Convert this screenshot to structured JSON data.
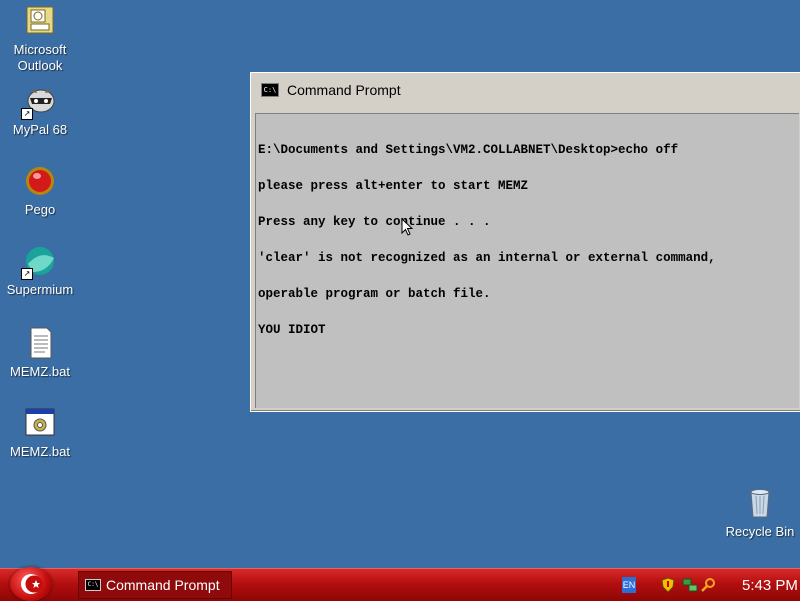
{
  "desktop": {
    "icons": [
      {
        "label_line1": "Microsoft",
        "label_line2": "Outlook",
        "icon": "outlook-icon"
      },
      {
        "label": "MyPal 68",
        "icon": "mypal-icon"
      },
      {
        "label": "Pego",
        "icon": "pego-icon"
      },
      {
        "label": "Supermium",
        "icon": "supermium-icon"
      },
      {
        "label": "MEMZ.bat",
        "icon": "text-file-icon"
      },
      {
        "label": "MEMZ.bat",
        "icon": "batch-file-icon"
      }
    ],
    "recycle_bin": {
      "label": "Recycle Bin",
      "icon": "recycle-bin-icon"
    }
  },
  "cmd_window": {
    "title": "Command Prompt",
    "icon_text": "C:\\",
    "lines": [
      "E:\\Documents and Settings\\VM2.COLLABNET\\Desktop>echo off",
      "please press alt+enter to start MEMZ",
      "Press any key to continue . . .",
      "'clear' is not recognized as an internal or external command,",
      "operable program or batch file.",
      "YOU IDIOT"
    ]
  },
  "taskbar": {
    "task_label": "Command Prompt",
    "language": "EN",
    "clock": "5:43 PM"
  },
  "colors": {
    "desktop": "#3a6ea5",
    "taskbar": "#b30f0f",
    "console_bg": "#c0c0c0"
  }
}
